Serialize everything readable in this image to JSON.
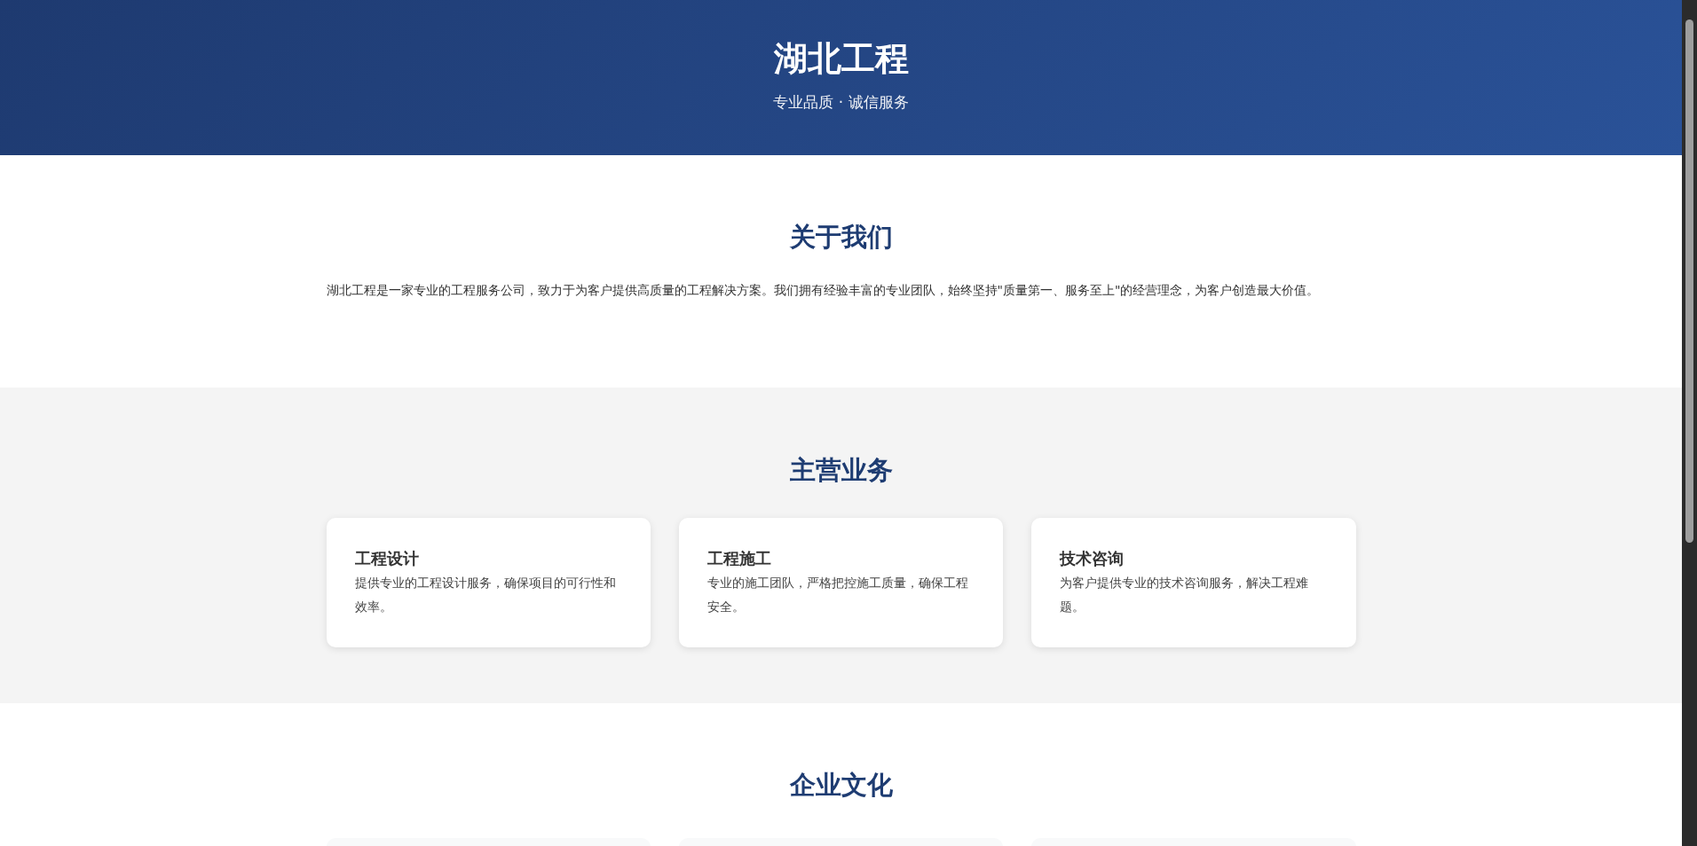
{
  "header": {
    "title": "湖北工程",
    "subtitle": "专业品质 · 诚信服务"
  },
  "about": {
    "title": "关于我们",
    "text": "湖北工程是一家专业的工程服务公司，致力于为客户提供高质量的工程解决方案。我们拥有经验丰富的专业团队，始终坚持\"质量第一、服务至上\"的经营理念，为客户创造最大价值。"
  },
  "services": {
    "title": "主营业务",
    "cards": [
      {
        "title": "工程设计",
        "text": "提供专业的工程设计服务，确保项目的可行性和效率。"
      },
      {
        "title": "工程施工",
        "text": "专业的施工团队，严格把控施工质量，确保工程安全。"
      },
      {
        "title": "技术咨询",
        "text": "为客户提供专业的技术咨询服务，解决工程难题。"
      }
    ]
  },
  "culture": {
    "title": "企业文化"
  }
}
